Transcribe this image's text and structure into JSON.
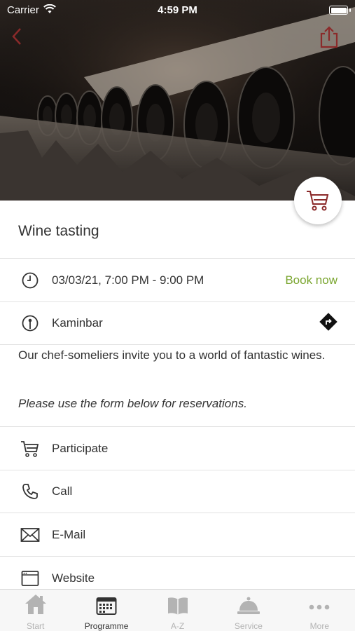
{
  "status_bar": {
    "carrier": "Carrier",
    "time": "4:59 PM"
  },
  "event": {
    "title": "Wine tasting",
    "datetime": "03/03/21, 7:00 PM - 9:00 PM",
    "book_label": "Book now",
    "location": "Kaminbar",
    "description": "Our chef-someliers invite you to a world of fantastic wines.",
    "note": "Please use the form below for reservations."
  },
  "actions": [
    {
      "label": "Participate",
      "icon": "cart-icon"
    },
    {
      "label": "Call",
      "icon": "phone-icon"
    },
    {
      "label": "E-Mail",
      "icon": "mail-icon"
    },
    {
      "label": "Website",
      "icon": "browser-icon"
    }
  ],
  "tabs": [
    {
      "label": "Start",
      "icon": "home-icon",
      "active": false
    },
    {
      "label": "Programme",
      "icon": "calendar-icon",
      "active": true
    },
    {
      "label": "A-Z",
      "icon": "book-icon",
      "active": false
    },
    {
      "label": "Service",
      "icon": "bell-icon",
      "active": false
    },
    {
      "label": "More",
      "icon": "more-icon",
      "active": false
    }
  ],
  "colors": {
    "accent": "#8b2a2a",
    "book_now": "#7aa52f",
    "separator": "#e2e2e2",
    "tab_inactive": "#b3b3b3"
  }
}
